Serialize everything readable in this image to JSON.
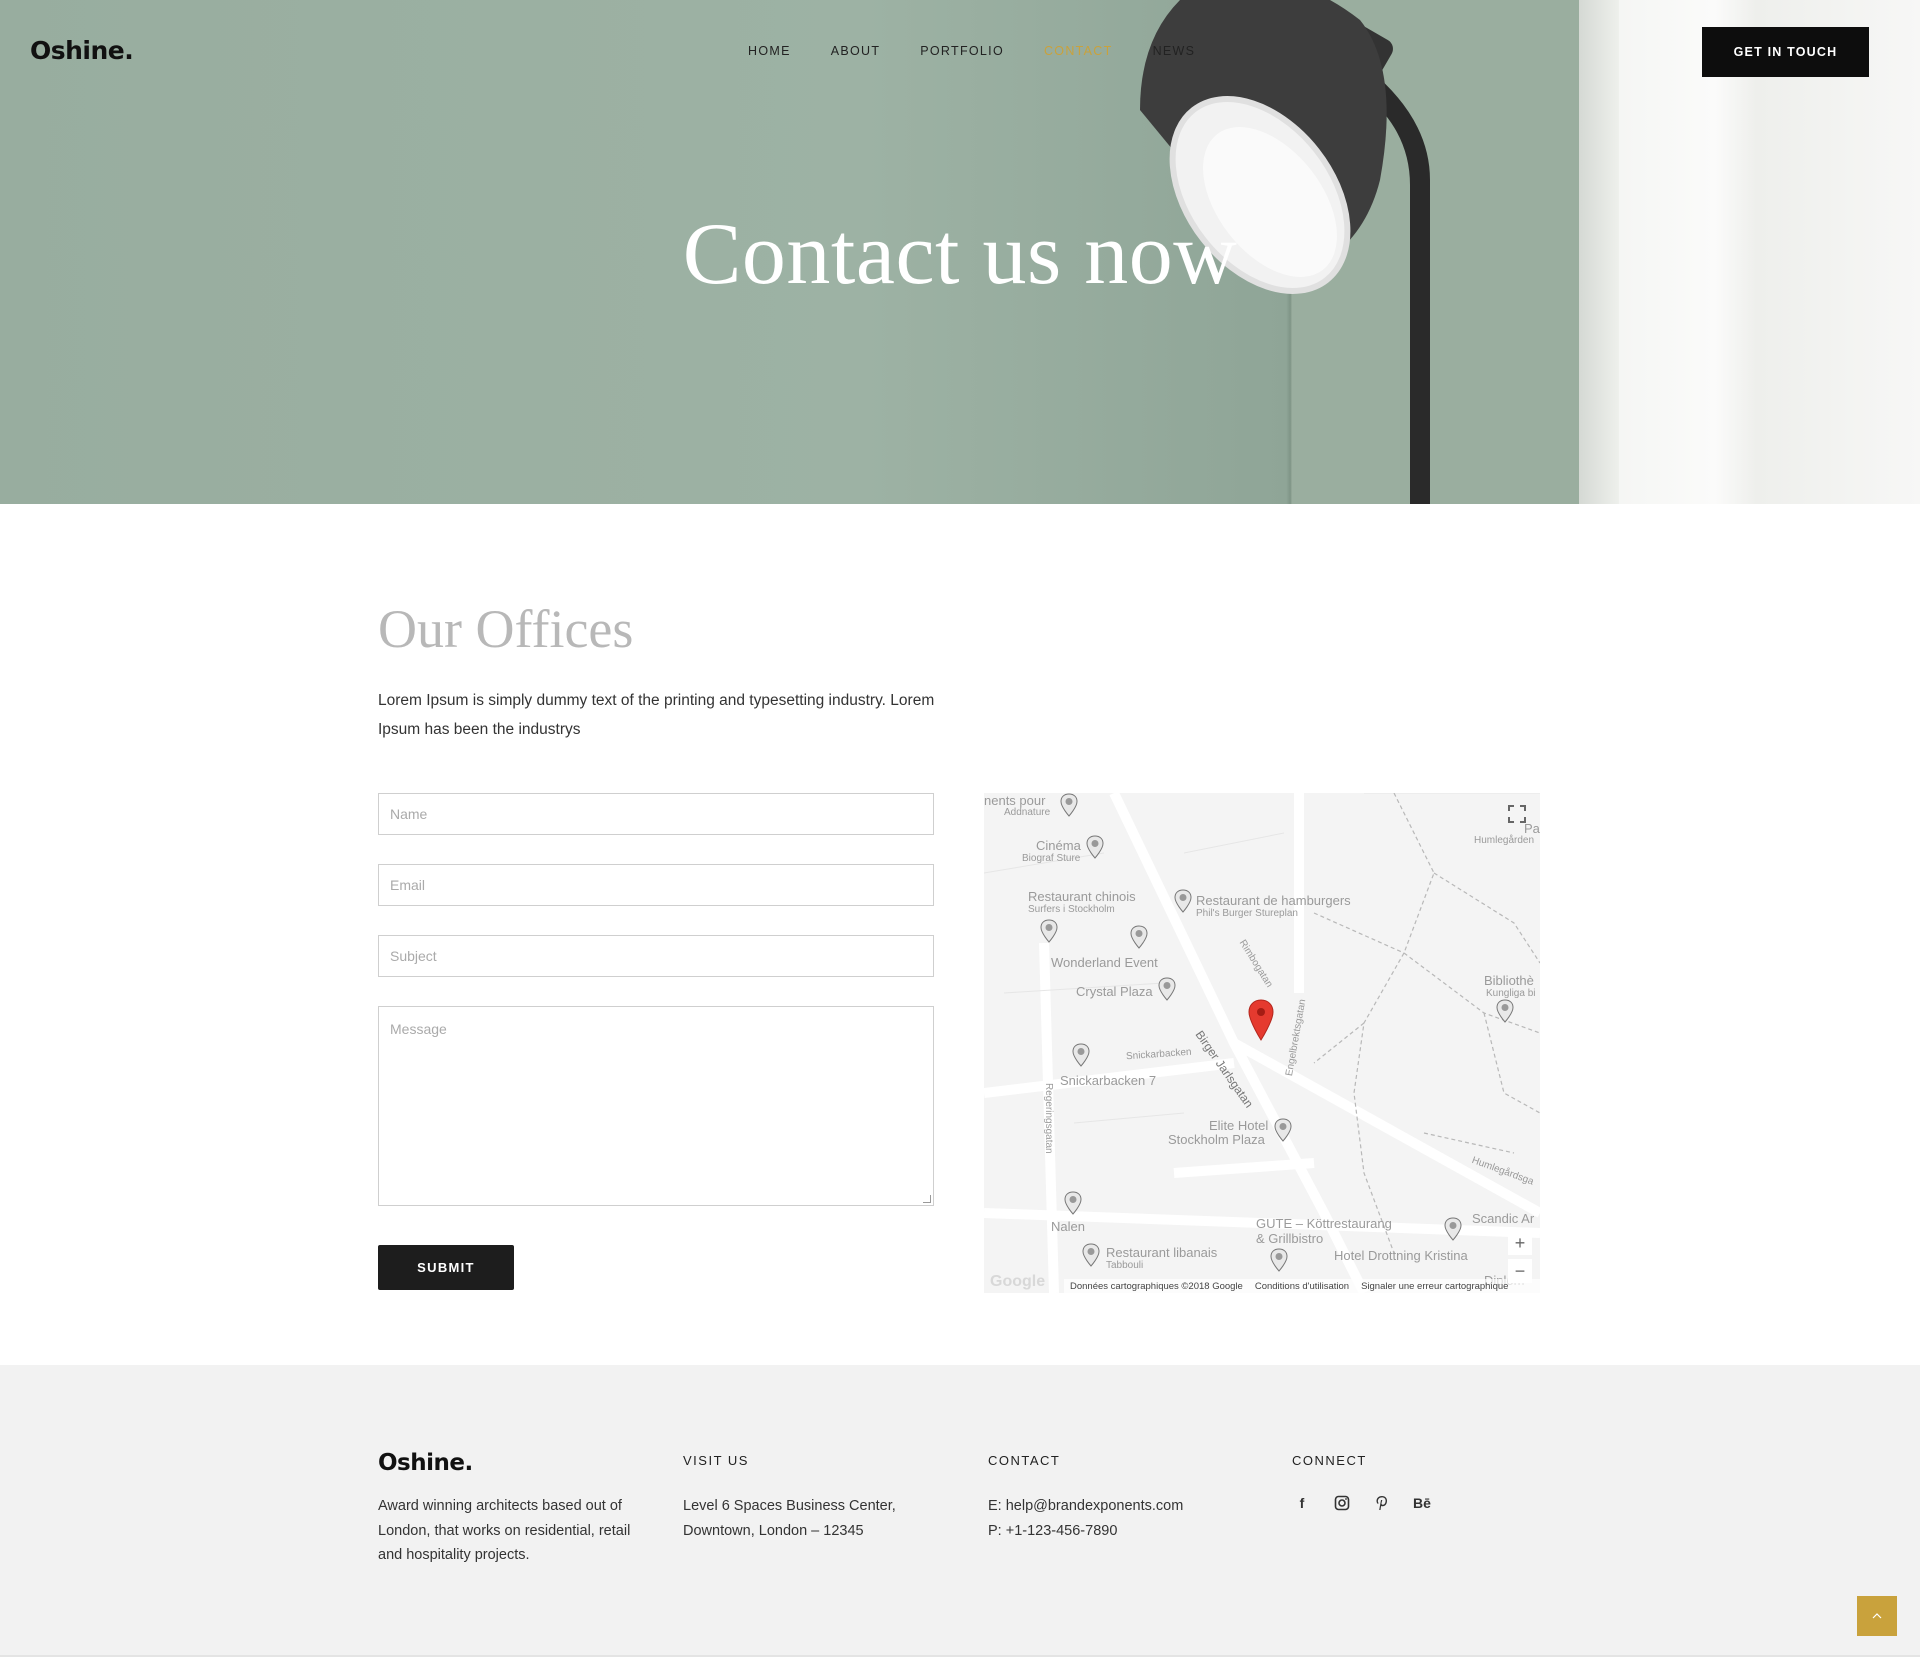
{
  "header": {
    "logo": "Oshine.",
    "nav": [
      "HOME",
      "ABOUT",
      "PORTFOLIO",
      "CONTACT",
      "NEWS"
    ],
    "active_nav": "CONTACT",
    "cta": "GET IN TOUCH"
  },
  "hero": {
    "title": "Contact us now"
  },
  "offices": {
    "title": "Our Offices",
    "intro": "Lorem Ipsum is simply dummy text of the printing and typesetting industry. Lorem Ipsum has been the industrys"
  },
  "form": {
    "name_placeholder": "Name",
    "email_placeholder": "Email",
    "subject_placeholder": "Subject",
    "message_placeholder": "Message",
    "submit": "SUBMIT"
  },
  "map": {
    "labels": {
      "l1": "nents pour",
      "l1b": "Addnature",
      "cinema": "Cinéma",
      "cinema_sub": "Biograf Sture",
      "chinois": "Restaurant chinois",
      "chinois_sub": "Surfers i Stockholm",
      "hamburgers": "Restaurant de hamburgers",
      "hamburgers_sub": "Phil's Burger Stureplan",
      "wonderland": "Wonderland Event",
      "crystal": "Crystal Plaza",
      "rimbo": "Rimbogatan",
      "engel": "Engelbrektsgatan",
      "snick_street": "Snickarbacken",
      "snick7": "Snickarbacken 7",
      "birger": "Birger Jarlsgatan",
      "regering": "Regeringsgatan",
      "elite1": "Elite Hotel",
      "elite2": "Stockholm Plaza",
      "nalen": "Nalen",
      "gute1": "GUTE – Köttrestaurang",
      "gute2": "& Grillbistro",
      "libanais": "Restaurant libanais",
      "libanais_sub": "Tabbouli",
      "drottning": "Hotel Drottning Kristina",
      "biblio": "Bibliothè",
      "biblio_sub": "Kungliga bi",
      "humle": "Humlegården",
      "humle2": "Humlegårdsga",
      "parc": "Parc",
      "scandic": "Scandic Ar",
      "dip": "Diplom"
    },
    "attribution": [
      "Données cartographiques ©2018 Google",
      "Conditions d'utilisation",
      "Signaler une erreur cartographique"
    ],
    "google": "Google",
    "zoom_in": "+",
    "zoom_out": "−"
  },
  "footer": {
    "logo": "Oshine.",
    "about": "Award winning architects based out of London, that works on residential, retail and hospitality projects.",
    "visit_heading": "VISIT US",
    "visit_l1": "Level 6 Spaces Business Center,",
    "visit_l2": "Downtown, London – 12345",
    "contact_heading": "CONTACT",
    "contact_email": "E: help@brandexponents.com",
    "contact_phone": "P: +1-123-456-7890",
    "connect_heading": "CONNECT",
    "social": [
      "f",
      "instagram-icon",
      "pinterest-icon",
      "Bē"
    ]
  },
  "colors": {
    "accent": "#c9a23c",
    "hero_bg": "#9db2a4",
    "dark": "#1d1d1d"
  }
}
